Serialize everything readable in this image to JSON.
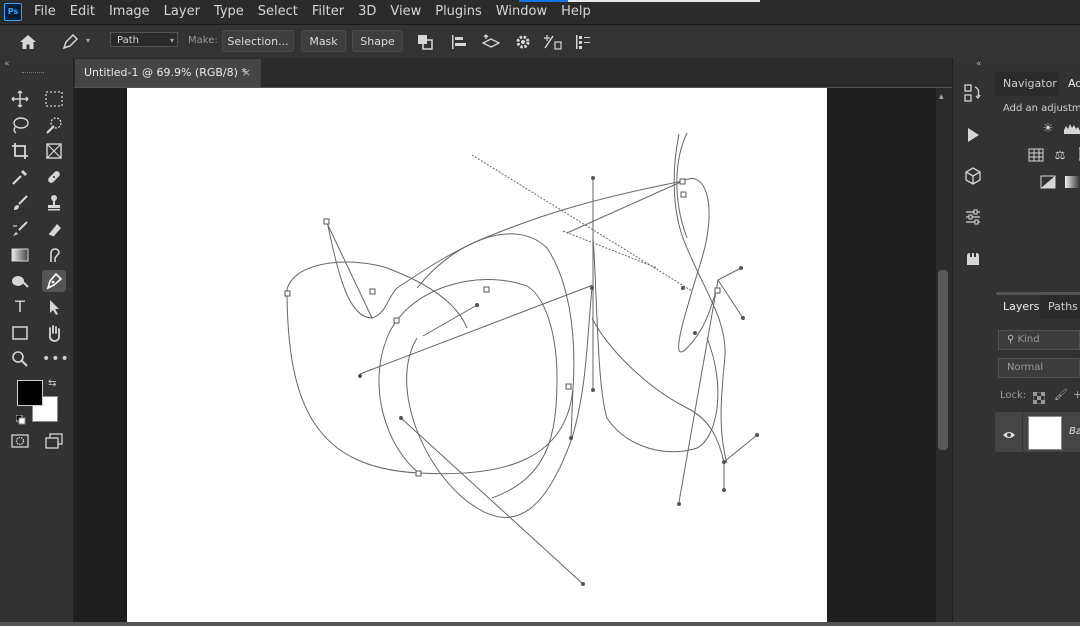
{
  "app": {
    "logo": "Ps"
  },
  "menu": [
    "File",
    "Edit",
    "Image",
    "Layer",
    "Type",
    "Select",
    "Filter",
    "3D",
    "View",
    "Plugins",
    "Window",
    "Help"
  ],
  "options": {
    "mode": "Path",
    "make_label": "Make:",
    "selection_btn": "Selection...",
    "mask_btn": "Mask",
    "shape_btn": "Shape"
  },
  "document": {
    "tab_title": "Untitled-1 @ 69.9% (RGB/8) *",
    "close": "×"
  },
  "panels": {
    "navigator_tab": "Navigator",
    "adjustments_tab": "Ad",
    "adjust_hint": "Add an adjustme",
    "layers_tab": "Layers",
    "paths_tab": "Paths",
    "kind_placeholder": "Kind",
    "blend_mode": "Normal",
    "lock_label": "Lock:",
    "layer_name": "Ba"
  },
  "colors": {
    "accent": "#1473e6",
    "foreground": "#000000",
    "background": "#ffffff"
  },
  "icons": {
    "tools": [
      "move",
      "marquee",
      "lasso",
      "quick-select",
      "crop",
      "frame",
      "eyedropper",
      "healing",
      "brush",
      "stamp",
      "history-brush",
      "eraser",
      "gradient",
      "smudge",
      "dodge",
      "pen",
      "type",
      "path-select",
      "rectangle",
      "hand",
      "zoom",
      "more"
    ],
    "strip": [
      "history",
      "play",
      "3d",
      "properties",
      "libraries"
    ]
  }
}
